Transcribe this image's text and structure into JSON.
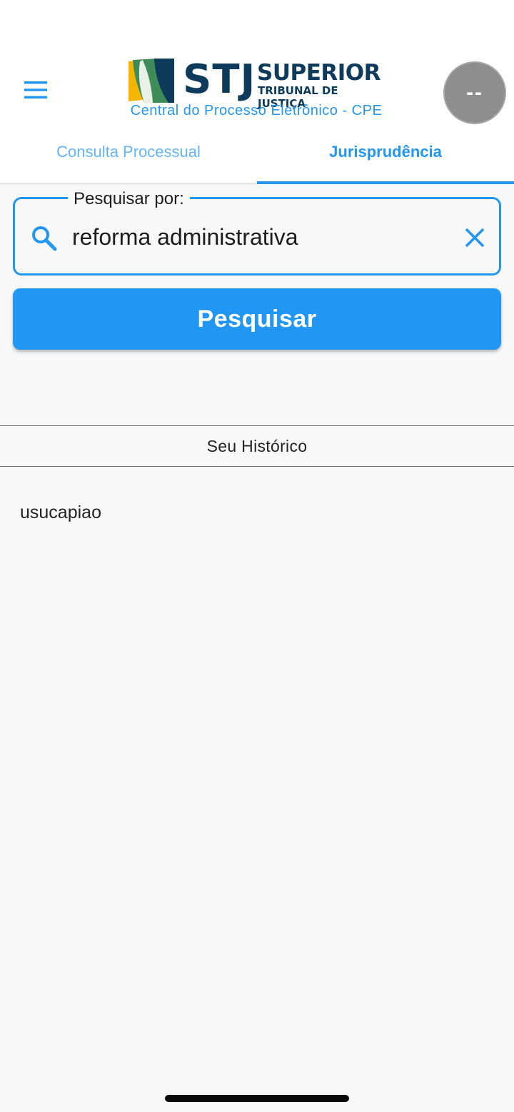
{
  "header": {
    "logo": {
      "acronym": "STJ",
      "name_line1": "SUPERIOR",
      "name_line2": "TRIBUNAL DE JUSTIÇA"
    },
    "subtitle": "Central do Processo Eletrônico - CPE",
    "avatar_text": "--",
    "menu_icon": "hamburger-menu-icon"
  },
  "tabs": [
    {
      "label": "Consulta Processual",
      "active": false
    },
    {
      "label": "Jurisprudência",
      "active": true
    }
  ],
  "search": {
    "legend": "Pesquisar por:",
    "value": "reforma administrativa",
    "search_icon": "search-icon",
    "clear_icon": "close-icon",
    "button_label": "Pesquisar"
  },
  "history": {
    "title": "Seu Histórico",
    "items": [
      "usucapiao"
    ]
  },
  "colors": {
    "accent": "#2196f3",
    "accent_light": "#64b5f6",
    "brand_dark": "#0e3a5c",
    "avatar_bg": "#8e8e8e",
    "background": "#f8f8f8"
  }
}
